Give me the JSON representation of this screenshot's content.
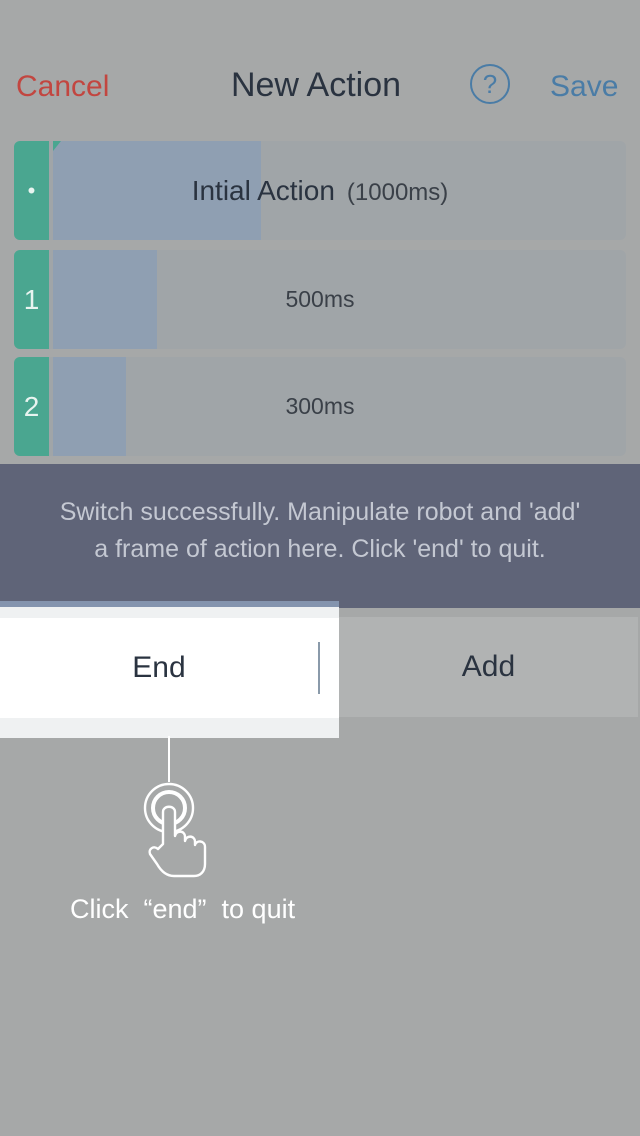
{
  "header": {
    "cancel_label": "Cancel",
    "title": "New Action",
    "help_label": "?",
    "save_label": "Save"
  },
  "actions": [
    {
      "index_label": "•",
      "name": "Intial Action",
      "duration": "(1000ms)",
      "progress_fraction": 0.34
    },
    {
      "index_label": "1",
      "duration": "500ms",
      "progress_fraction": 0.17
    },
    {
      "index_label": "2",
      "duration": "300ms",
      "progress_fraction": 0.12
    }
  ],
  "banner": {
    "line1": "Switch successfully. Manipulate robot and 'add'",
    "line2": "a frame of action here. Click 'end' to quit."
  },
  "buttons": {
    "end_label": "End",
    "add_label": "Add"
  },
  "hint": {
    "text": "Click  “end”  to quit",
    "icon": "tap-hand-icon"
  },
  "colors": {
    "cancel": "#c24640",
    "accent_blue": "#4a7ca6",
    "row_tab_green": "#4aa690",
    "banner_bg": "#5f6478"
  }
}
